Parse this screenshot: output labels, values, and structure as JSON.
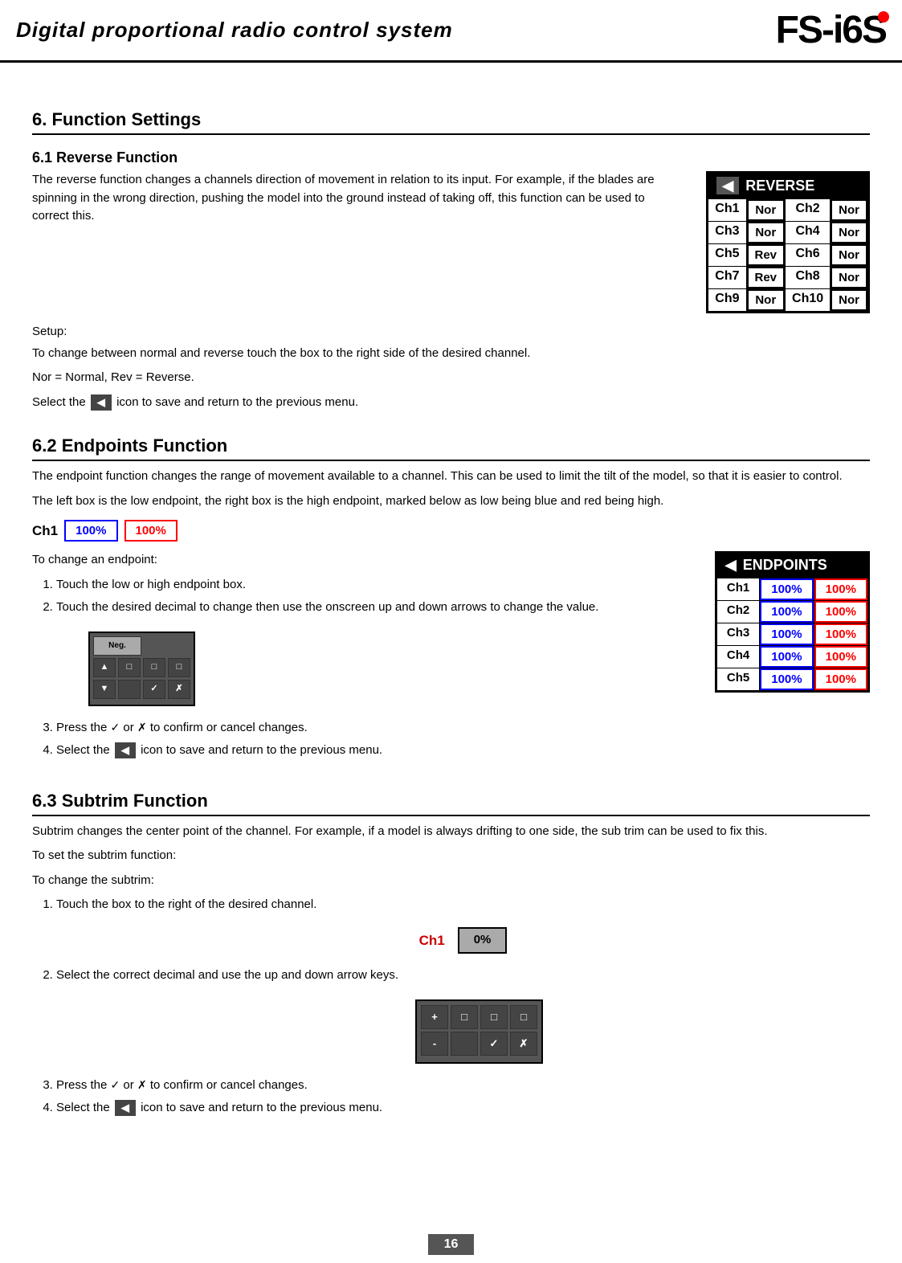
{
  "header": {
    "title": "Digital proportional radio control system",
    "logo": "FS-i6S"
  },
  "sections": {
    "s6_title": "6. Function Settings",
    "s61": {
      "title": "6.1 Reverse Function",
      "description1": "The reverse function changes a channels direction of movement in relation to its input. For example, if the blades are spinning in the wrong direction, pushing the model into the ground instead of taking off, this function can be used to correct this.",
      "setup_label": "Setup:",
      "setup_text1": "To change between normal and reverse touch the box to the right side of the desired channel.",
      "nor_rev": "Nor = Normal, Rev = Reverse.",
      "save_text": "icon to save and return to the previous menu.",
      "select_text": "Select the"
    },
    "s62": {
      "title": "6.2 Endpoints Function",
      "desc1": "The endpoint function changes the range of movement available to a channel. This can be used to limit the tilt of the model, so that it is easier to control.",
      "desc2": "The left box is the low endpoint, the right box is the high endpoint, marked below as low being blue and red being high.",
      "ch1_label": "Ch1",
      "ch1_box1": "100%",
      "ch1_box2": "100%",
      "change_endpoint": "To change an endpoint:",
      "step1": "Touch the low or high endpoint box.",
      "step2": "Touch the desired decimal to change then use the onscreen up and down arrows to change the value.",
      "step3": "Press the ✓ or ✗ to confirm or cancel changes.",
      "step4": "Select the",
      "step4b": "icon to save and return to the previous menu.",
      "keypad_neg": "Neg.",
      "keypad_check": "✓",
      "keypad_x": "✗"
    },
    "s63": {
      "title": "6.3 Subtrim Function",
      "desc1": "Subtrim changes the center point of the channel. For example, if a model is always drifting to one side, the sub trim can be used to fix this.",
      "to_set": "To set the subtrim function:",
      "to_change": "To change the subtrim:",
      "step1": "Touch the box to the right of the desired channel.",
      "ch1_label": "Ch1",
      "ch1_value": "0%",
      "step2": "Select the correct decimal and use the up and down arrow keys.",
      "step3": "Press the ✓ or ✗ to confirm or cancel changes.",
      "step4": "Select the",
      "step4b": "icon to save and return to the previous menu."
    }
  },
  "reverse_table": {
    "header": "REVERSE",
    "rows": [
      [
        "Ch1",
        "Nor",
        "Ch2",
        "Nor"
      ],
      [
        "Ch3",
        "Nor",
        "Ch4",
        "Nor"
      ],
      [
        "Ch5",
        "Rev",
        "Ch6",
        "Nor"
      ],
      [
        "Ch7",
        "Rev",
        "Ch8",
        "Nor"
      ],
      [
        "Ch9",
        "Nor",
        "Ch10",
        "Nor"
      ]
    ]
  },
  "endpoints_table": {
    "header": "ENDPOINTS",
    "rows": [
      [
        "Ch1",
        "100%",
        "100%"
      ],
      [
        "Ch2",
        "100%",
        "100%"
      ],
      [
        "Ch3",
        "100%",
        "100%"
      ],
      [
        "Ch4",
        "100%",
        "100%"
      ],
      [
        "Ch5",
        "100%",
        "100%"
      ]
    ]
  },
  "page_number": "16"
}
